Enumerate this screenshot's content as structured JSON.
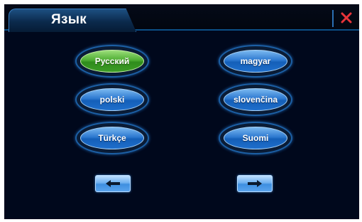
{
  "header": {
    "title": "Язык"
  },
  "languages": [
    {
      "label": "Русский",
      "selected": true
    },
    {
      "label": "magyar",
      "selected": false
    },
    {
      "label": "polski",
      "selected": false
    },
    {
      "label": "slovenčina",
      "selected": false
    },
    {
      "label": "Türkçe",
      "selected": false
    },
    {
      "label": "Suomi",
      "selected": false
    }
  ],
  "icons": {
    "close": "close-icon",
    "prev": "arrow-left-icon",
    "next": "arrow-right-icon"
  },
  "colors": {
    "background": "#00081c",
    "accent": "#1c5fa4",
    "selected": "#4fae34",
    "close": "#e8343a"
  }
}
